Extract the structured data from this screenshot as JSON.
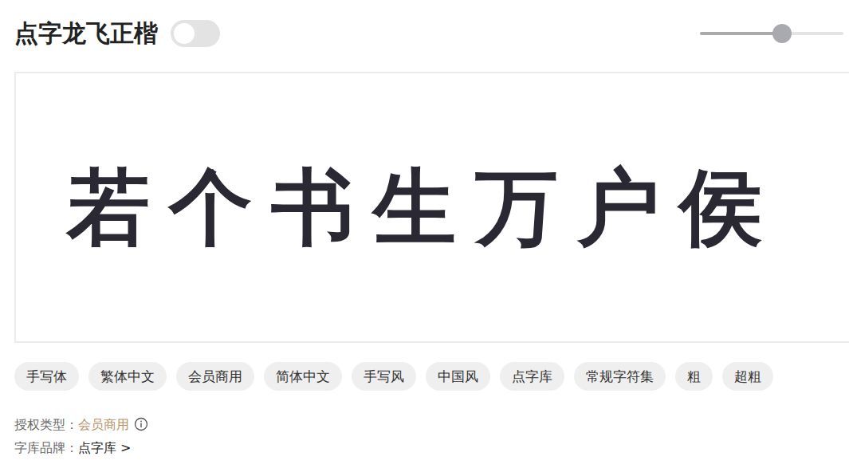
{
  "font": {
    "name": "点字龙飞正楷",
    "toggle_on": false,
    "size_level": 0.57
  },
  "preview": {
    "text": "若个书生万户侯"
  },
  "tags": [
    "手写体",
    "繁体中文",
    "会员商用",
    "简体中文",
    "手写风",
    "中国风",
    "点字库",
    "常规字符集",
    "粗",
    "超粗"
  ],
  "license": {
    "label": "授权类型：",
    "value": "会员商用"
  },
  "brand": {
    "label": "字库品牌：",
    "value": "点字库 >"
  }
}
